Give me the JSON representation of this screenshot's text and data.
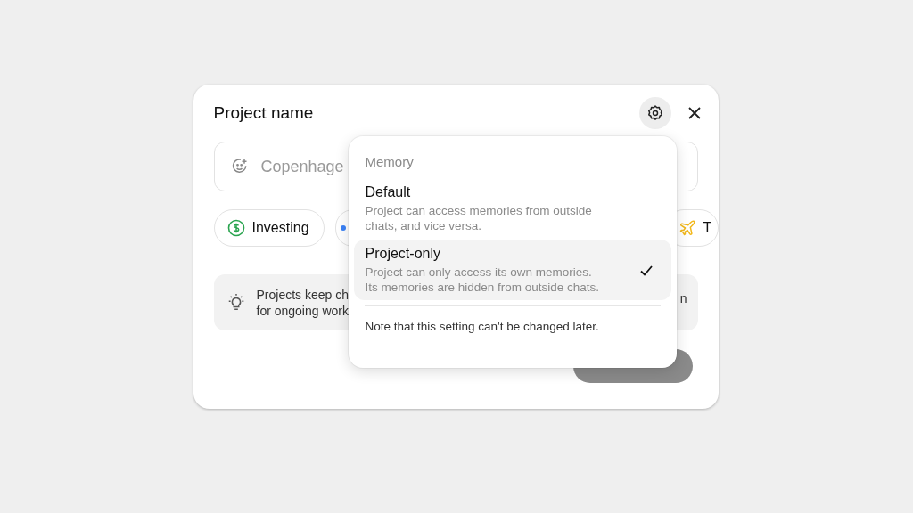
{
  "dialog": {
    "title": "Project name",
    "name_field": {
      "placeholder": "Copenhage"
    },
    "chips": [
      {
        "kind": "dollar",
        "label": "Investing"
      },
      {
        "kind": "blue"
      },
      {
        "kind": "plane",
        "label": "T"
      }
    ],
    "info": {
      "lines": [
        "Projects keep ch",
        "for ongoing work"
      ],
      "tail": "n"
    }
  },
  "memory_menu": {
    "heading": "Memory",
    "options": [
      {
        "label": "Default",
        "description": "Project can access memories from outside chats, and vice versa.",
        "selected": false
      },
      {
        "label": "Project-only",
        "description": "Project can only access its own memories. Its memories are hidden from outside chats.",
        "selected": true
      }
    ],
    "note": "Note that this setting can't be changed later."
  }
}
